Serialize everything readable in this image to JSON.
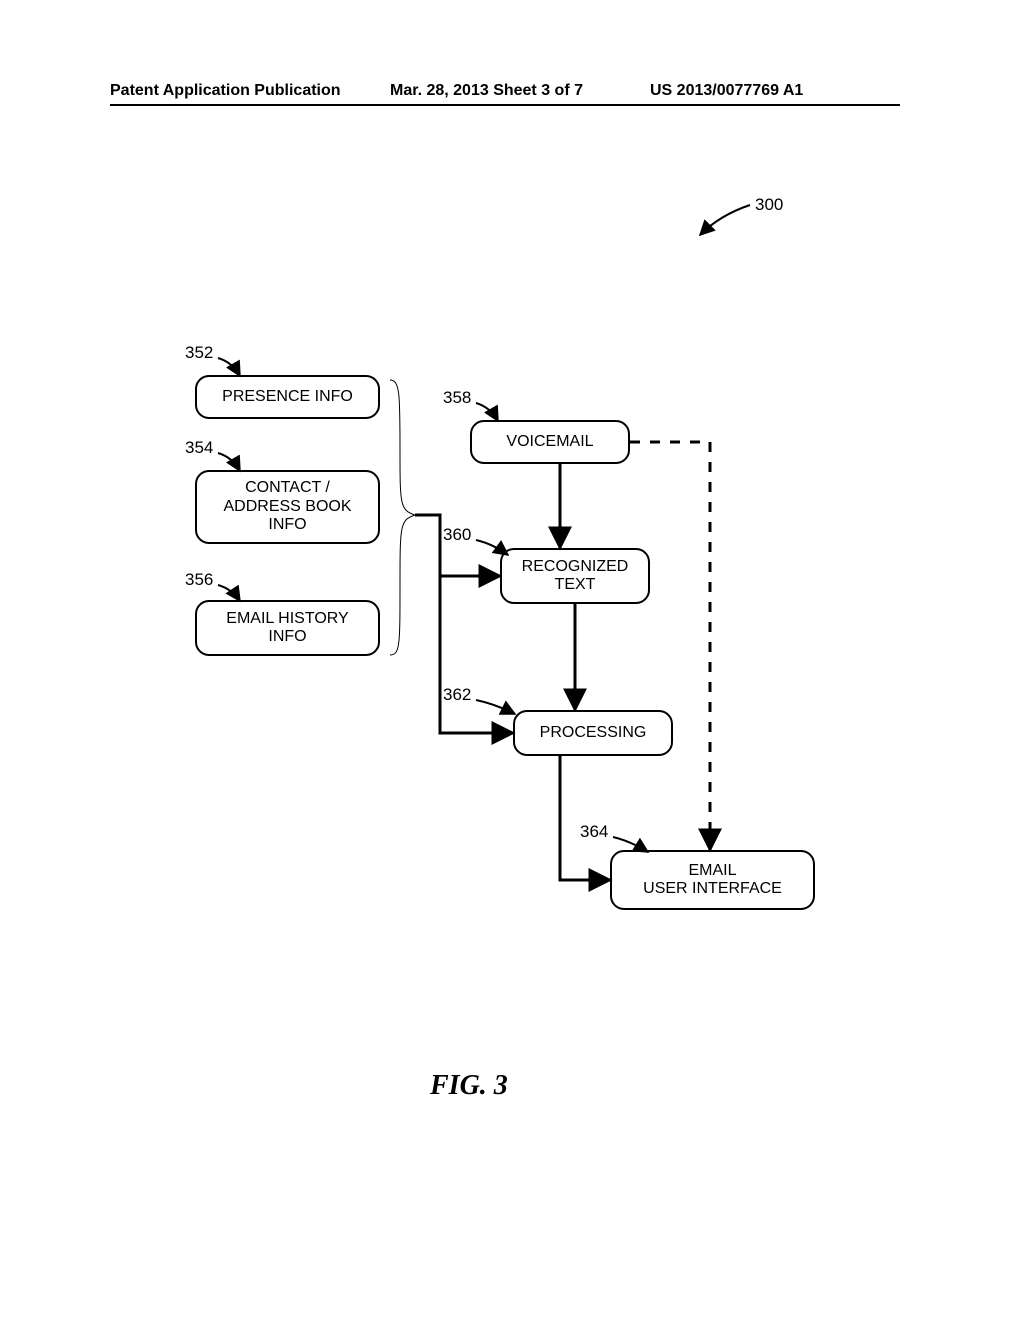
{
  "header": {
    "left": "Patent Application Publication",
    "center": "Mar. 28, 2013  Sheet 3 of 7",
    "right": "US 2013/0077769 A1"
  },
  "figure_caption": "FIG. 3",
  "refs": {
    "r300": "300",
    "r352": "352",
    "r354": "354",
    "r356": "356",
    "r358": "358",
    "r360": "360",
    "r362": "362",
    "r364": "364"
  },
  "nodes": {
    "presence": "PRESENCE INFO",
    "contact": "CONTACT /\nADDRESS BOOK\nINFO",
    "emailhist": "EMAIL HISTORY\nINFO",
    "voicemail": "VOICEMAIL",
    "recognized": "RECOGNIZED\nTEXT",
    "processing": "PROCESSING",
    "emailui": "EMAIL\nUSER INTERFACE"
  }
}
